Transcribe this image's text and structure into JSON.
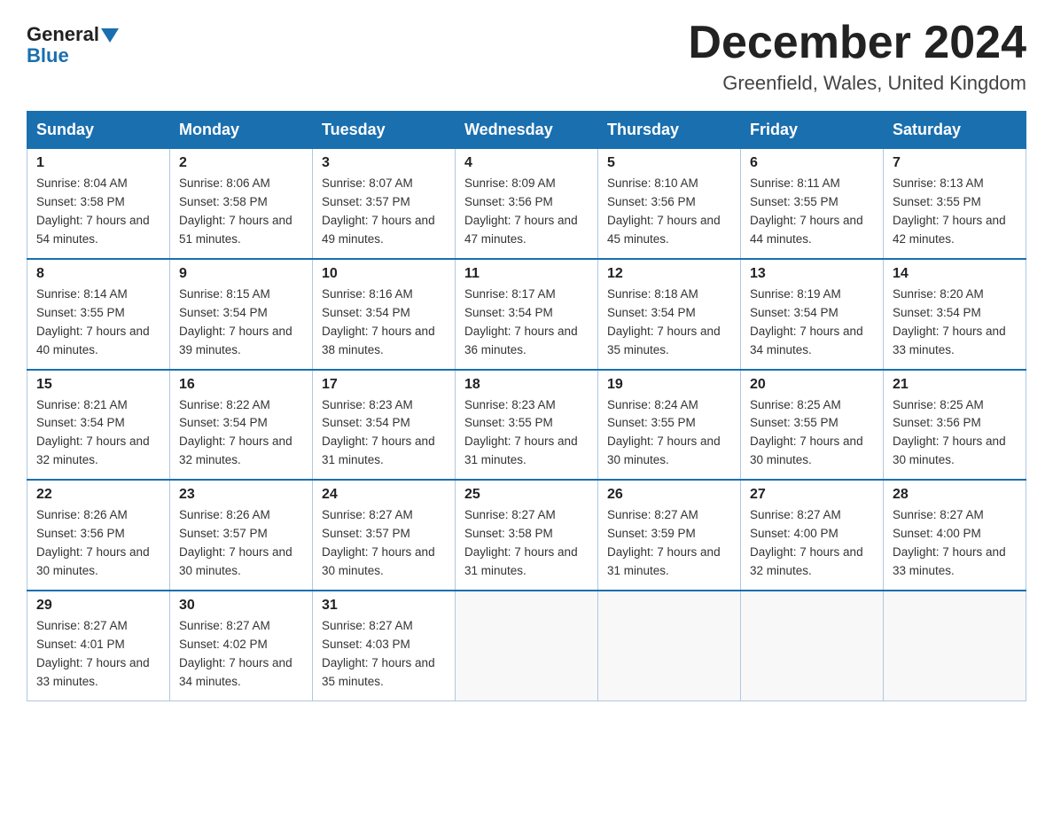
{
  "header": {
    "logo_general": "General",
    "logo_blue": "Blue",
    "month_title": "December 2024",
    "location": "Greenfield, Wales, United Kingdom"
  },
  "days_of_week": [
    "Sunday",
    "Monday",
    "Tuesday",
    "Wednesday",
    "Thursday",
    "Friday",
    "Saturday"
  ],
  "weeks": [
    [
      {
        "day": "1",
        "sunrise": "8:04 AM",
        "sunset": "3:58 PM",
        "daylight": "7 hours and 54 minutes."
      },
      {
        "day": "2",
        "sunrise": "8:06 AM",
        "sunset": "3:58 PM",
        "daylight": "7 hours and 51 minutes."
      },
      {
        "day": "3",
        "sunrise": "8:07 AM",
        "sunset": "3:57 PM",
        "daylight": "7 hours and 49 minutes."
      },
      {
        "day": "4",
        "sunrise": "8:09 AM",
        "sunset": "3:56 PM",
        "daylight": "7 hours and 47 minutes."
      },
      {
        "day": "5",
        "sunrise": "8:10 AM",
        "sunset": "3:56 PM",
        "daylight": "7 hours and 45 minutes."
      },
      {
        "day": "6",
        "sunrise": "8:11 AM",
        "sunset": "3:55 PM",
        "daylight": "7 hours and 44 minutes."
      },
      {
        "day": "7",
        "sunrise": "8:13 AM",
        "sunset": "3:55 PM",
        "daylight": "7 hours and 42 minutes."
      }
    ],
    [
      {
        "day": "8",
        "sunrise": "8:14 AM",
        "sunset": "3:55 PM",
        "daylight": "7 hours and 40 minutes."
      },
      {
        "day": "9",
        "sunrise": "8:15 AM",
        "sunset": "3:54 PM",
        "daylight": "7 hours and 39 minutes."
      },
      {
        "day": "10",
        "sunrise": "8:16 AM",
        "sunset": "3:54 PM",
        "daylight": "7 hours and 38 minutes."
      },
      {
        "day": "11",
        "sunrise": "8:17 AM",
        "sunset": "3:54 PM",
        "daylight": "7 hours and 36 minutes."
      },
      {
        "day": "12",
        "sunrise": "8:18 AM",
        "sunset": "3:54 PM",
        "daylight": "7 hours and 35 minutes."
      },
      {
        "day": "13",
        "sunrise": "8:19 AM",
        "sunset": "3:54 PM",
        "daylight": "7 hours and 34 minutes."
      },
      {
        "day": "14",
        "sunrise": "8:20 AM",
        "sunset": "3:54 PM",
        "daylight": "7 hours and 33 minutes."
      }
    ],
    [
      {
        "day": "15",
        "sunrise": "8:21 AM",
        "sunset": "3:54 PM",
        "daylight": "7 hours and 32 minutes."
      },
      {
        "day": "16",
        "sunrise": "8:22 AM",
        "sunset": "3:54 PM",
        "daylight": "7 hours and 32 minutes."
      },
      {
        "day": "17",
        "sunrise": "8:23 AM",
        "sunset": "3:54 PM",
        "daylight": "7 hours and 31 minutes."
      },
      {
        "day": "18",
        "sunrise": "8:23 AM",
        "sunset": "3:55 PM",
        "daylight": "7 hours and 31 minutes."
      },
      {
        "day": "19",
        "sunrise": "8:24 AM",
        "sunset": "3:55 PM",
        "daylight": "7 hours and 30 minutes."
      },
      {
        "day": "20",
        "sunrise": "8:25 AM",
        "sunset": "3:55 PM",
        "daylight": "7 hours and 30 minutes."
      },
      {
        "day": "21",
        "sunrise": "8:25 AM",
        "sunset": "3:56 PM",
        "daylight": "7 hours and 30 minutes."
      }
    ],
    [
      {
        "day": "22",
        "sunrise": "8:26 AM",
        "sunset": "3:56 PM",
        "daylight": "7 hours and 30 minutes."
      },
      {
        "day": "23",
        "sunrise": "8:26 AM",
        "sunset": "3:57 PM",
        "daylight": "7 hours and 30 minutes."
      },
      {
        "day": "24",
        "sunrise": "8:27 AM",
        "sunset": "3:57 PM",
        "daylight": "7 hours and 30 minutes."
      },
      {
        "day": "25",
        "sunrise": "8:27 AM",
        "sunset": "3:58 PM",
        "daylight": "7 hours and 31 minutes."
      },
      {
        "day": "26",
        "sunrise": "8:27 AM",
        "sunset": "3:59 PM",
        "daylight": "7 hours and 31 minutes."
      },
      {
        "day": "27",
        "sunrise": "8:27 AM",
        "sunset": "4:00 PM",
        "daylight": "7 hours and 32 minutes."
      },
      {
        "day": "28",
        "sunrise": "8:27 AM",
        "sunset": "4:00 PM",
        "daylight": "7 hours and 33 minutes."
      }
    ],
    [
      {
        "day": "29",
        "sunrise": "8:27 AM",
        "sunset": "4:01 PM",
        "daylight": "7 hours and 33 minutes."
      },
      {
        "day": "30",
        "sunrise": "8:27 AM",
        "sunset": "4:02 PM",
        "daylight": "7 hours and 34 minutes."
      },
      {
        "day": "31",
        "sunrise": "8:27 AM",
        "sunset": "4:03 PM",
        "daylight": "7 hours and 35 minutes."
      },
      null,
      null,
      null,
      null
    ]
  ]
}
